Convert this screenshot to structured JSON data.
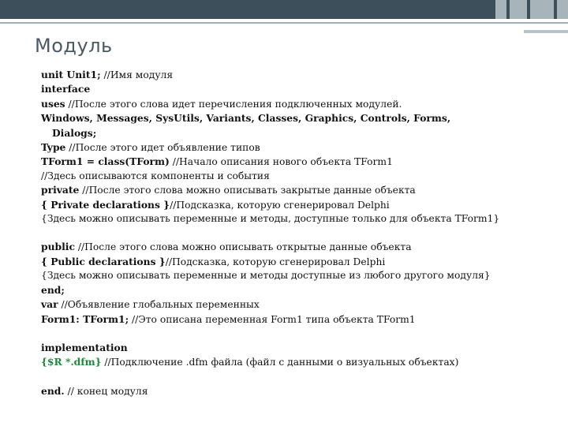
{
  "title": "Модуль",
  "lines": {
    "l1_a": "unit Unit1;",
    "l1_b": " //Имя модуля",
    "l2": "interface",
    "l3_a": "uses",
    "l3_b": " //После этого слова идет перечисления подключенных модулей.",
    "l4_a": "Windows, Messages, SysUtils, Variants, Classes, Graphics, Controls, Forms,",
    "l4_b": "Dialogs;",
    "l5_a": "Type",
    "l5_b": " //После этого идет объявление типов",
    "l6_a": "TForm1 = class(TForm)",
    "l6_b": " //Начало описания нового объекта TForm1",
    "l7": "//Здесь описываются компоненты и события",
    "l8_a": "private",
    "l8_b": " //После этого слова можно описывать закрытые данные объекта",
    "l9_a": "{ Private declarations }",
    "l9_b": "//Подсказка, которую сгенерировал Delphi",
    "l10": "{Здесь можно описывать переменные и методы, доступные только для объекта TForm1}",
    "l11_a": "public",
    "l11_b": " //После этого слова можно описывать открытые данные объекта",
    "l12_a": "{ Public declarations }",
    "l12_b": "//Подсказка, которую сгенерировал Delphi",
    "l13": "{Здесь можно описывать переменные и методы доступные из любого другого модуля}",
    "l14": "end;",
    "l15_a": "var",
    "l15_b": " //Объявление глобальных переменных",
    "l16_a": "Form1: TForm1;",
    "l16_b": " //Это описана переменная Form1 типа объекта TForm1",
    "l17": "implementation",
    "l18_a": "{$R *.dfm}",
    "l18_b": " //Подключение .dfm файла (файл с данными о визуальных объектах)",
    "l19_a": "end.",
    "l19_b": " // конец модуля"
  },
  "colors": {
    "topbar": "#3d4f5a",
    "title": "#4a5a63",
    "directive": "#1a8a3c"
  }
}
